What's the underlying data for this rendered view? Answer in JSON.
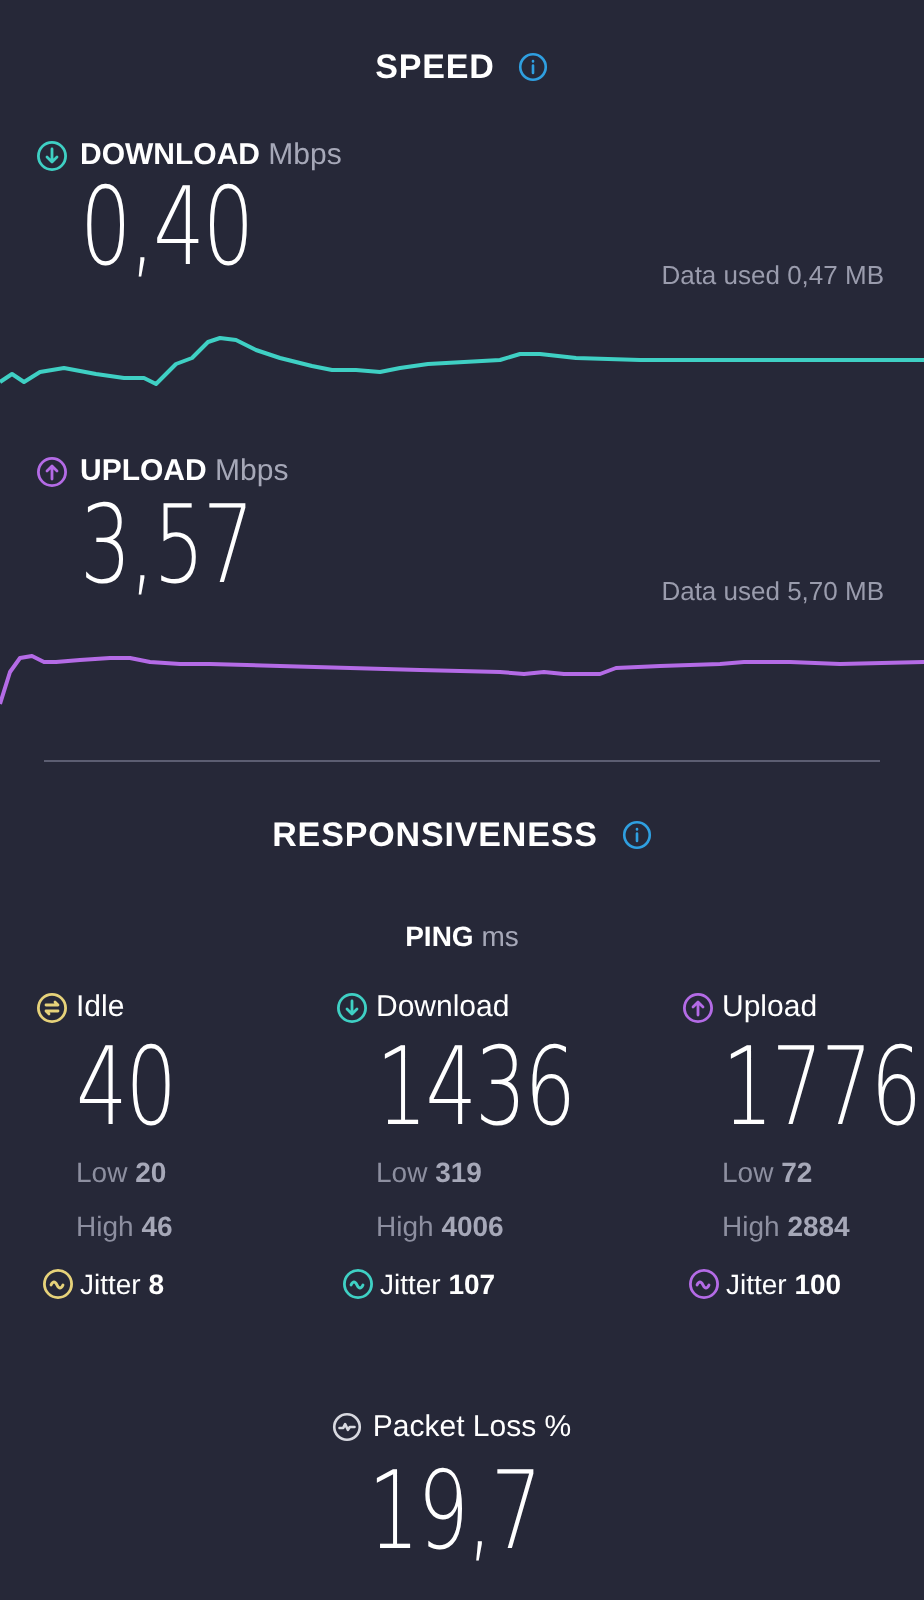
{
  "speed": {
    "title": "SPEED",
    "metrics": [
      {
        "kind": "download",
        "label": "DOWNLOAD",
        "unit": "Mbps",
        "value": "0,40",
        "data_used": "Data used 0,47 MB",
        "color": "#3fd0c4"
      },
      {
        "kind": "upload",
        "label": "UPLOAD",
        "unit": "Mbps",
        "value": "3,57",
        "data_used": "Data used 5,70 MB",
        "color": "#b46be6"
      }
    ]
  },
  "responsiveness": {
    "title": "RESPONSIVENESS",
    "ping_label": "PING",
    "ping_unit": "ms",
    "columns": [
      {
        "kind": "idle",
        "label": "Idle",
        "value": "40",
        "low_label": "Low",
        "low": "20",
        "high_label": "High",
        "high": "46",
        "jitter_label": "Jitter",
        "jitter": "8",
        "color": "#e6d27a"
      },
      {
        "kind": "download",
        "label": "Download",
        "value": "1436",
        "low_label": "Low",
        "low": "319",
        "high_label": "High",
        "high": "4006",
        "jitter_label": "Jitter",
        "jitter": "107",
        "color": "#3fd0c4"
      },
      {
        "kind": "upload",
        "label": "Upload",
        "value": "1776",
        "low_label": "Low",
        "low": "72",
        "high_label": "High",
        "high": "2884",
        "jitter_label": "Jitter",
        "jitter": "100",
        "color": "#b46be6"
      }
    ]
  },
  "packet_loss": {
    "label": "Packet Loss %",
    "value": "19,7"
  }
}
